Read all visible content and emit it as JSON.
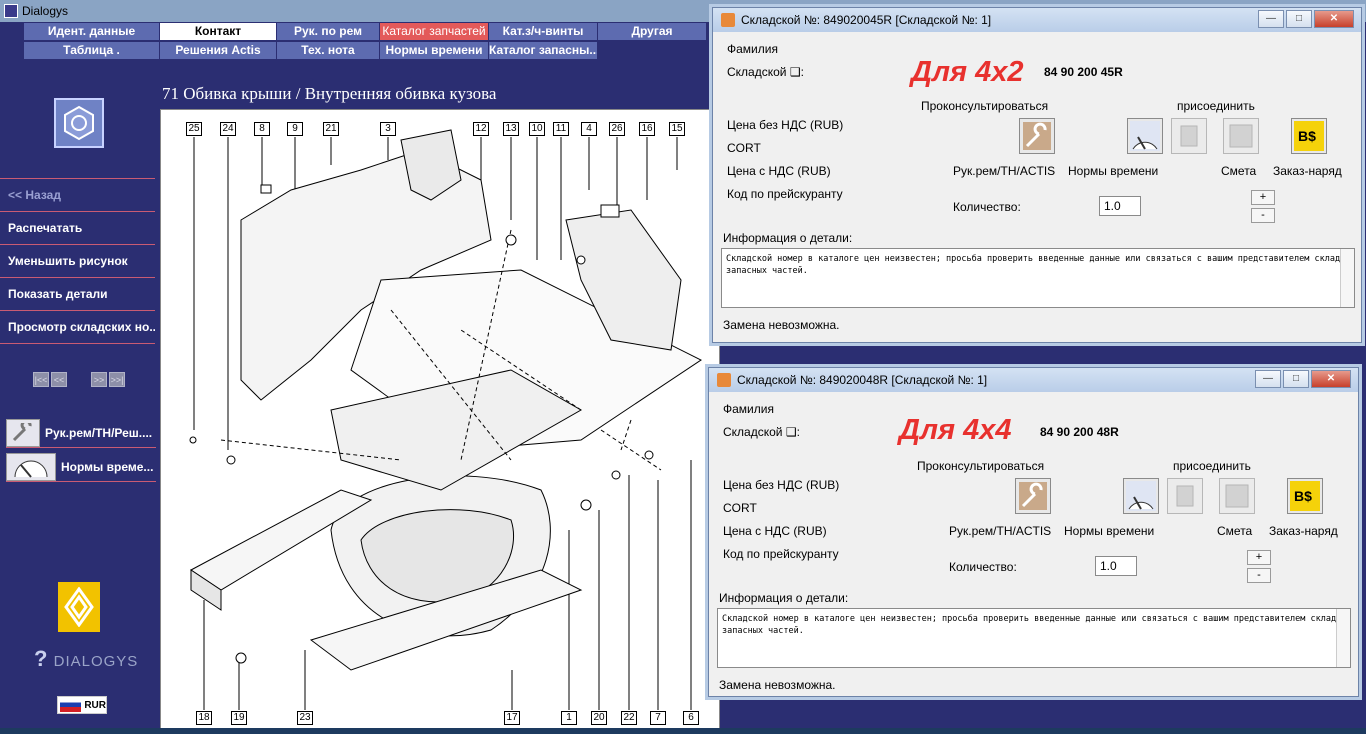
{
  "window": {
    "title": "Dialogys"
  },
  "tabs_row1": [
    "Идент. данные",
    "Контакт",
    "Рук. по рем",
    "Каталог запчастей",
    "Кат.з/ч-винты",
    "Другая"
  ],
  "tabs_row2": [
    "Таблица .",
    "Решения Actis",
    "Тех. нота",
    "Нормы времени",
    "Каталог запасны..."
  ],
  "sidebar": {
    "back": "<< Назад",
    "print": "Распечатать",
    "zoom_out": "Уменьшить рисунок",
    "show_details": "Показать детали",
    "stock_view": "Просмотр складских но...",
    "pager": [
      "|<<",
      "<<",
      "",
      ">>",
      ">>|"
    ],
    "tool1": "Рук.рем/ТН/Реш....",
    "tool2": "Нормы време...",
    "brand": "DIALOGYS",
    "lang": "RUR"
  },
  "diagram": {
    "title": "71 Обивка крыши / Внутренняя обивка кузова",
    "top_callouts": [
      "25",
      "24",
      "8",
      "9",
      "21",
      "3",
      "12",
      "13",
      "10",
      "11",
      "4",
      "26",
      "16",
      "15"
    ],
    "bottom_callouts": [
      "18",
      "19",
      "23",
      "17",
      "1",
      "20",
      "22",
      "7",
      "6"
    ]
  },
  "dialog1": {
    "title": "Складской №: 849020045R [Складской №: 1]",
    "surname_label": "Фамилия",
    "stock_label": "Складской ❑:",
    "annotation": "Для 4х2",
    "part_number": "84 90 200 45R",
    "consult": "Проконсультироваться",
    "attach": "присоединить",
    "price_no_vat": "Цена без НДС (RUB)",
    "cort": "CORT",
    "price_vat": "Цена с НДС (RUB)",
    "price_code": "Код по прейскуранту",
    "btn_manual": "Рук.рем/ТН/ACTIS",
    "btn_times": "Нормы времени",
    "btn_estimate": "Смета",
    "btn_order": "Заказ-наряд",
    "qty_label": "Количество:",
    "qty_value": "1.0",
    "plus": "+",
    "minus": "-",
    "info_label": "Информация о детали:",
    "info_text": "Складской номер в каталоге цен неизвестен; просьба проверить введенные данные или связаться с вашим представителем склада запасных частей.",
    "status": "Замена невозможна."
  },
  "dialog2": {
    "title": "Складской №: 849020048R [Складской №: 1]",
    "surname_label": "Фамилия",
    "stock_label": "Складской ❑:",
    "annotation": "Для 4х4",
    "part_number": "84 90 200 48R",
    "consult": "Проконсультироваться",
    "attach": "присоединить",
    "price_no_vat": "Цена без НДС (RUB)",
    "cort": "CORT",
    "price_vat": "Цена с НДС (RUB)",
    "price_code": "Код по прейскуранту",
    "btn_manual": "Рук.рем/ТН/ACTIS",
    "btn_times": "Нормы времени",
    "btn_estimate": "Смета",
    "btn_order": "Заказ-наряд",
    "qty_label": "Количество:",
    "qty_value": "1.0",
    "plus": "+",
    "minus": "-",
    "info_label": "Информация о детали:",
    "info_text": "Складской номер в каталоге цен неизвестен; просьба проверить введенные данные или связаться с вашим представителем склада запасных частей.",
    "status": "Замена невозможна."
  }
}
